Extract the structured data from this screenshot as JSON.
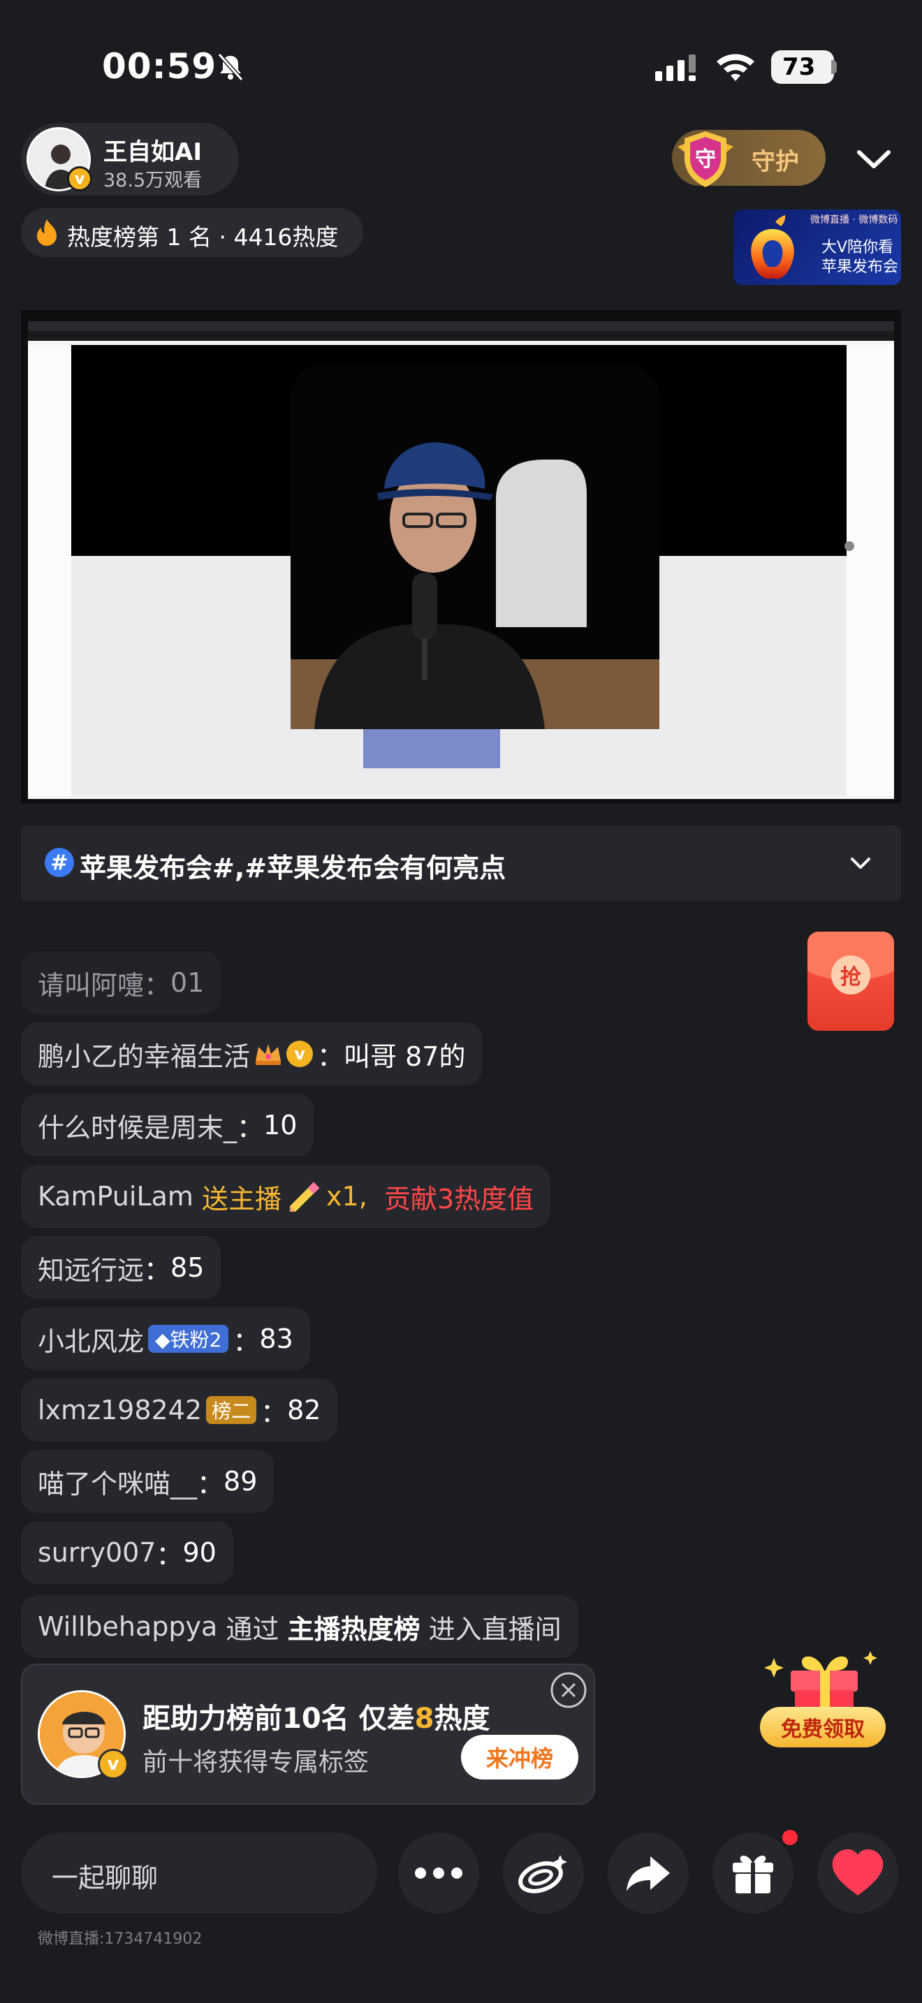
{
  "status_bar": {
    "time": "00:59",
    "battery": "73"
  },
  "host": {
    "name": "王自如AI",
    "viewers": "38.5万观看"
  },
  "guard": {
    "icon_char": "守",
    "label": "守护"
  },
  "heat": {
    "text": "热度榜第 1 名 · 4416热度"
  },
  "promo": {
    "tag": "微博直播 · 微博数码",
    "line1": "大V陪你看",
    "line2": "苹果发布会"
  },
  "topic": {
    "hash": "#",
    "text": "苹果发布会#,#苹果发布会有何亮点"
  },
  "red_packet": {
    "label": "抢"
  },
  "chat": [
    {
      "user": "请叫阿嚏",
      "sep": "：",
      "msg": "01"
    },
    {
      "user": "鹏小乙的幸福生活",
      "v": "v",
      "sep": "：",
      "msg": "叫哥 87的"
    },
    {
      "user": "什么时候是周末_",
      "sep": "：",
      "msg": "10"
    },
    {
      "user": "KamPuiLam",
      "gift_text": "送主播",
      "gift_count": "x1,",
      "gift_heat": "贡献3热度值"
    },
    {
      "user": "知远行远",
      "sep": "：",
      "msg": "85"
    },
    {
      "user": "小北风龙",
      "badge": "◆铁粉2",
      "sep": "：",
      "msg": "83"
    },
    {
      "user": "lxmz198242",
      "badge": "榜二",
      "sep": "：",
      "msg": "82"
    },
    {
      "user": "喵了个咪喵__",
      "sep": "：",
      "msg": "89"
    },
    {
      "user": "surry007",
      "sep": "：",
      "msg": "90"
    },
    {
      "user": "Willbehappya",
      "via": "通过",
      "source": "主播热度榜",
      "action": "进入直播间"
    }
  ],
  "boost": {
    "title_pre": "距助力榜前10名 仅差",
    "title_num": "8",
    "title_post": "热度",
    "subtitle": "前十将获得专属标签",
    "button": "来冲榜",
    "v": "v"
  },
  "free_gift": {
    "label": "免费领取"
  },
  "bottom": {
    "input_placeholder": "一起聊聊",
    "room_id": "微博直播:1734741902"
  },
  "colors": {
    "accent_gold": "#f7b731",
    "accent_red": "#ff4747",
    "accent_blue": "#3b7cf6",
    "bg": "#1b1c20"
  }
}
